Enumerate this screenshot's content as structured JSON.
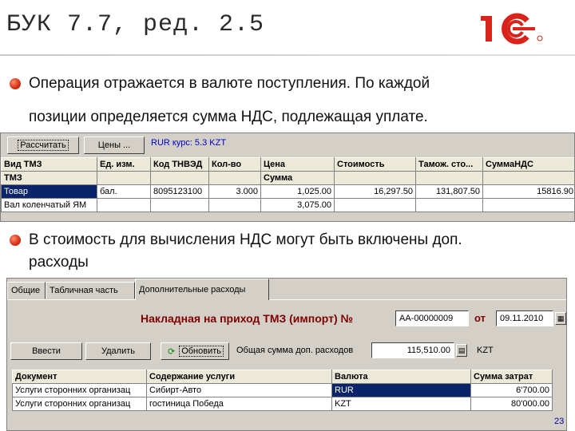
{
  "title": "БУК 7.7, ред. 2.5",
  "bullets": {
    "b1_line1": "Операция отражается в валюте поступления. По каждой",
    "b1_line2": "позиции определяется сумма НДС, подлежащая уплате.",
    "b2_line1": "В стоимость для вычисления НДС могут быть включены доп.",
    "b2_line2": "расходы"
  },
  "panel1": {
    "calc_button": "Рассчитать",
    "prices_button": "Цены ...",
    "rate_text": "RUR курс: 5.3 KZT",
    "headers_row1": [
      "Вид ТМЗ",
      "Ед. изм.",
      "Код ТНВЭД",
      "Кол-во",
      "Цена",
      "Стоимость",
      "Тамож. сто...",
      "СуммаНДС"
    ],
    "headers_row2": [
      "ТМЗ",
      "",
      "",
      "",
      "Сумма",
      "",
      "",
      ""
    ],
    "row1": [
      "Товар",
      "бал.",
      "8095123100",
      "3.000",
      "1,025.00",
      "16,297.50",
      "131,807.50",
      "15816.90"
    ],
    "row2": [
      "Вал коленчатый ЯМ",
      "",
      "",
      "",
      "3,075.00",
      "",
      "",
      ""
    ]
  },
  "panel2": {
    "tabs": [
      "Общие",
      "Табличная часть",
      "Дополнительные расходы"
    ],
    "doc_title": "Накладная на приход ТМЗ (импорт) №",
    "doc_number": "АА-00000009",
    "from_label": "от",
    "doc_date": "09.11.2010",
    "enter_button": "Ввести",
    "delete_button": "Удалить",
    "refresh_button": "Обновить",
    "total_label": "Общая сумма доп. расходов",
    "total_value": "115,510.00",
    "currency": "KZT",
    "headers": [
      "Документ",
      "Содержание услуги",
      "Валюта",
      "Сумма затрат"
    ],
    "rows": [
      [
        "Услуги сторонних организац",
        "Сибирт-Авто",
        "RUR",
        "6'700.00"
      ],
      [
        "Услуги сторонних организац",
        "гостиница Победа",
        "KZT",
        "80'000.00"
      ]
    ]
  },
  "page_number": "23"
}
